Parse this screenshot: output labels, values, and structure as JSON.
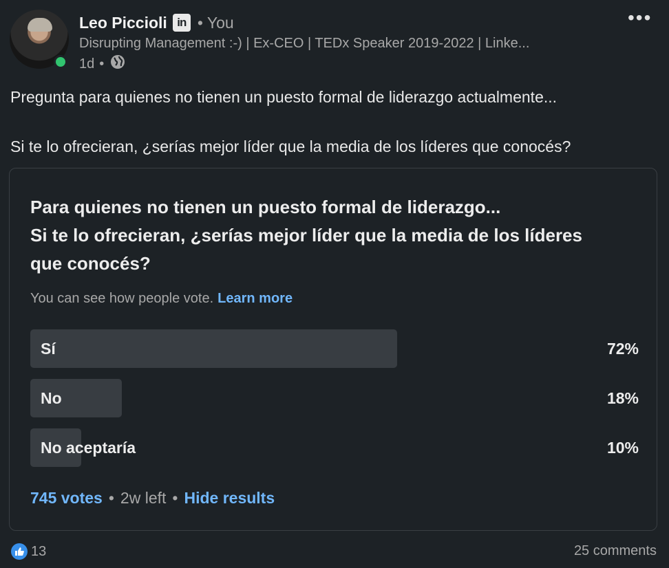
{
  "author": {
    "name": "Leo Piccioli",
    "network_badge_icon": "linkedin-icon",
    "relation": "You",
    "headline": "Disrupting Management :-) | Ex-CEO | TEDx Speaker 2019-2022 | Linke...",
    "time": "1d",
    "visibility_icon": "globe-icon",
    "online": true
  },
  "post": {
    "line1": "Pregunta para quienes no tienen un puesto formal de liderazgo actualmente...",
    "line2": "Si te lo ofrecieran, ¿serías mejor líder que la media de los líderes que conocés?"
  },
  "poll": {
    "question_lines": [
      "Para quienes no tienen un puesto formal de liderazgo...",
      "Si te lo ofrecieran, ¿serías mejor líder que la media de los líderes",
      "que conocés?"
    ],
    "visibility_note": "You can see how people vote.",
    "learn_more": "Learn more",
    "options": [
      {
        "label": "Sí",
        "percent_text": "72%",
        "percent": 72
      },
      {
        "label": "No",
        "percent_text": "18%",
        "percent": 18
      },
      {
        "label": "No aceptaría",
        "percent_text": "10%",
        "percent": 10
      }
    ],
    "votes": "745 votes",
    "time_left": "2w left",
    "hide_results": "Hide results"
  },
  "social": {
    "reaction_icon": "like-icon",
    "reaction_count": "13",
    "comments": "25 comments"
  },
  "colors": {
    "background": "#1d2226",
    "link": "#71b7fb",
    "bar": "#383d42",
    "online": "#31c46f"
  }
}
